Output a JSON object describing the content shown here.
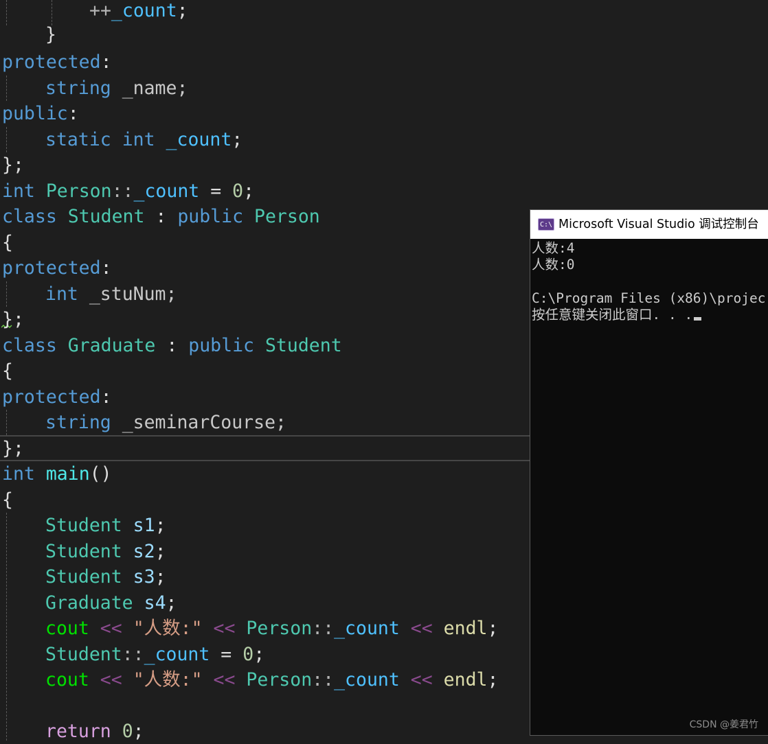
{
  "editor": {
    "l1": {
      "a": "++",
      "b": "_count",
      "c": ";"
    },
    "l2": {
      "a": "}"
    },
    "l3": {
      "a": "protected",
      "b": ":"
    },
    "l4": {
      "a": "string",
      "b": " _name;"
    },
    "l5": {
      "a": "public",
      "b": ":"
    },
    "l6": {
      "a": "static",
      "b": "int",
      "c": "_count",
      "d": ";"
    },
    "l7": {
      "a": "};"
    },
    "l8": {
      "a": "int",
      "b": "Person",
      "c": "::",
      "d": "_count",
      "e": " = ",
      "f": "0",
      "g": ";"
    },
    "l9": {
      "a": "class",
      "b": "Student",
      "c": " : ",
      "d": "public",
      "e": "Person"
    },
    "l10": {
      "a": "{"
    },
    "l11": {
      "a": "protected",
      "b": ":"
    },
    "l12": {
      "a": "int",
      "b": " _stuNum;"
    },
    "l13": {
      "a": "};"
    },
    "l14": {
      "a": "class",
      "b": "Graduate",
      "c": " : ",
      "d": "public",
      "e": "Student"
    },
    "l15": {
      "a": "{"
    },
    "l16": {
      "a": "protected",
      "b": ":"
    },
    "l17": {
      "a": "string",
      "b": " _seminarCourse;"
    },
    "l18": {
      "a": "};"
    },
    "l19": {
      "a": "int",
      "b": "main",
      "c": "()"
    },
    "l20": {
      "a": "{"
    },
    "l21": {
      "a": "Student",
      "b": "s1",
      "c": ";"
    },
    "l22": {
      "a": "Student",
      "b": "s2",
      "c": ";"
    },
    "l23": {
      "a": "Student",
      "b": "s3",
      "c": ";"
    },
    "l24": {
      "a": "Graduate",
      "b": "s4",
      "c": ";"
    },
    "l25": {
      "a": "cout",
      "b": "<<",
      "c": "\"人数:\"",
      "d": "<<",
      "e": "Person",
      "f": "::",
      "g": "_count",
      "h": "<<",
      "i": "endl",
      "j": ";"
    },
    "l26": {
      "a": "Student",
      "b": "::",
      "c": "_count",
      "d": " = ",
      "e": "0",
      "f": ";"
    },
    "l27": {
      "a": "cout",
      "b": "<<",
      "c": "\"人数:\"",
      "d": "<<",
      "e": "Person",
      "f": "::",
      "g": "_count",
      "h": "<<",
      "i": "endl",
      "j": ";"
    },
    "l29": {
      "a": "return",
      "b": "0",
      "c": ";"
    }
  },
  "console": {
    "title": "Microsoft Visual Studio 调试控制台",
    "icon_text": "C:\\",
    "lines": [
      "人数:4",
      "人数:0",
      "",
      "C:\\Program Files (x86)\\projec",
      "按任意键关闭此窗口. . ."
    ]
  },
  "watermark": "CSDN @姜君竹",
  "colors": {
    "editor_bg": "#1e1e1e",
    "keyword": "#569cd6",
    "type": "#4ec9b0",
    "static_member": "#4fc1ff",
    "number": "#b5cea8",
    "string": "#d69d85",
    "console_bg": "#0c0c0c",
    "console_text": "#cccccc"
  }
}
